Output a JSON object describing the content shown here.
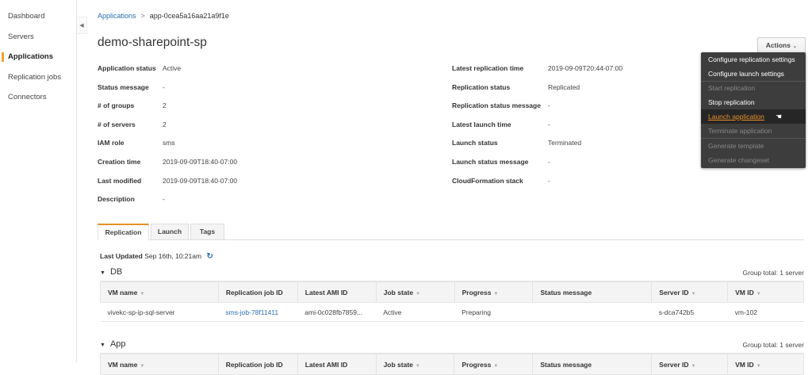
{
  "sidebar": {
    "items": [
      {
        "label": "Dashboard"
      },
      {
        "label": "Servers"
      },
      {
        "label": "Applications",
        "active": true
      },
      {
        "label": "Replication jobs"
      },
      {
        "label": "Connectors"
      }
    ]
  },
  "breadcrumb": {
    "parent": "Applications",
    "separator": ">",
    "current": "app-0cea5a16aa21a9f1e"
  },
  "title": "demo-sharepoint-sp",
  "details_left": [
    {
      "label": "Application status",
      "value": "Active"
    },
    {
      "label": "Status message",
      "value": "-"
    },
    {
      "label": "# of groups",
      "value": "2"
    },
    {
      "label": "# of servers",
      "value": "2"
    },
    {
      "label": "IAM role",
      "value": "sms"
    },
    {
      "label": "Creation time",
      "value": "2019-09-09T18:40-07:00"
    },
    {
      "label": "Last modified",
      "value": "2019-09-09T18:40-07:00"
    },
    {
      "label": "Description",
      "value": "-"
    }
  ],
  "details_right": [
    {
      "label": "Latest replication time",
      "value": "2019-09-09T20:44-07:00"
    },
    {
      "label": "Replication status",
      "value": "Replicated"
    },
    {
      "label": "Replication status message",
      "value": "-"
    },
    {
      "label": "Latest launch time",
      "value": "-"
    },
    {
      "label": "Launch status",
      "value": "Terminated"
    },
    {
      "label": "Launch status message",
      "value": "-"
    },
    {
      "label": "CloudFormation stack",
      "value": "-"
    }
  ],
  "actions": {
    "label": "Actions",
    "menu": [
      {
        "label": "Configure replication settings",
        "state": "enabled"
      },
      {
        "label": "Configure launch settings",
        "state": "enabled"
      },
      {
        "label": "Start replication",
        "state": "disabled"
      },
      {
        "label": "Stop replication",
        "state": "enabled"
      },
      {
        "label": "Launch application",
        "state": "hover"
      },
      {
        "label": "Terminate application",
        "state": "disabled"
      },
      {
        "label": "Generate template",
        "state": "disabled"
      },
      {
        "label": "Generate changeset",
        "state": "disabled"
      }
    ]
  },
  "tabs": [
    {
      "label": "Replication",
      "active": true
    },
    {
      "label": "Launch"
    },
    {
      "label": "Tags"
    }
  ],
  "last_updated": {
    "label": "Last Updated",
    "value": "Sep 16th, 10:21am"
  },
  "columns": [
    "VM name",
    "Replication job ID",
    "Latest AMI ID",
    "Job state",
    "Progress",
    "Status message",
    "Server ID",
    "VM ID"
  ],
  "groups": [
    {
      "name": "DB",
      "total": "Group total: 1 server",
      "rows": [
        [
          "vivekc-sp-ip-sql-server",
          "sms-job-78f11411",
          "ami-0c028fb7859...",
          "Active",
          "Preparing",
          "",
          "s-dca742b5",
          "vm-102"
        ]
      ]
    },
    {
      "name": "App",
      "total": "Group total: 1 server",
      "rows": []
    }
  ]
}
